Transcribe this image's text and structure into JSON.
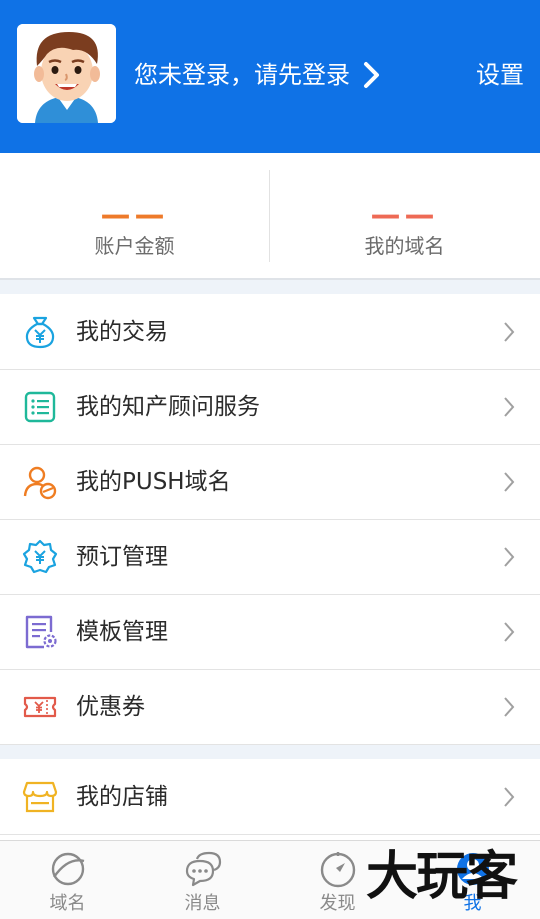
{
  "header": {
    "login_prompt": "您未登录，请先登录",
    "settings_label": "设置",
    "background_color": "#0f72e6"
  },
  "stats": [
    {
      "value": "——",
      "label": "账户金额",
      "color": "#ee7a2a"
    },
    {
      "value": "——",
      "label": "我的域名",
      "color": "#ee6a55"
    }
  ],
  "menu": [
    {
      "label": "我的交易",
      "icon": "money-bag-icon",
      "color": "#1aa3e0"
    },
    {
      "label": "我的知产顾问服务",
      "icon": "list-document-icon",
      "color": "#1fb89a"
    },
    {
      "label": "我的PUSH域名",
      "icon": "user-exchange-icon",
      "color": "#ef7d22"
    },
    {
      "label": "预订管理",
      "icon": "gear-yen-icon",
      "color": "#1aa3e0"
    },
    {
      "label": "模板管理",
      "icon": "template-settings-icon",
      "color": "#7c6bd1"
    },
    {
      "label": "优惠券",
      "icon": "coupon-icon",
      "color": "#e25a4a"
    },
    {
      "label": "我的店铺",
      "icon": "store-icon",
      "color": "#f0b323"
    }
  ],
  "tabs": [
    {
      "label": "域名",
      "icon": "planet-icon",
      "active": false
    },
    {
      "label": "消息",
      "icon": "chat-bubbles-icon",
      "active": false
    },
    {
      "label": "发现",
      "icon": "compass-icon",
      "active": false
    },
    {
      "label": "我",
      "icon": "user-icon",
      "active": true
    }
  ],
  "watermark_text": "大玩客"
}
